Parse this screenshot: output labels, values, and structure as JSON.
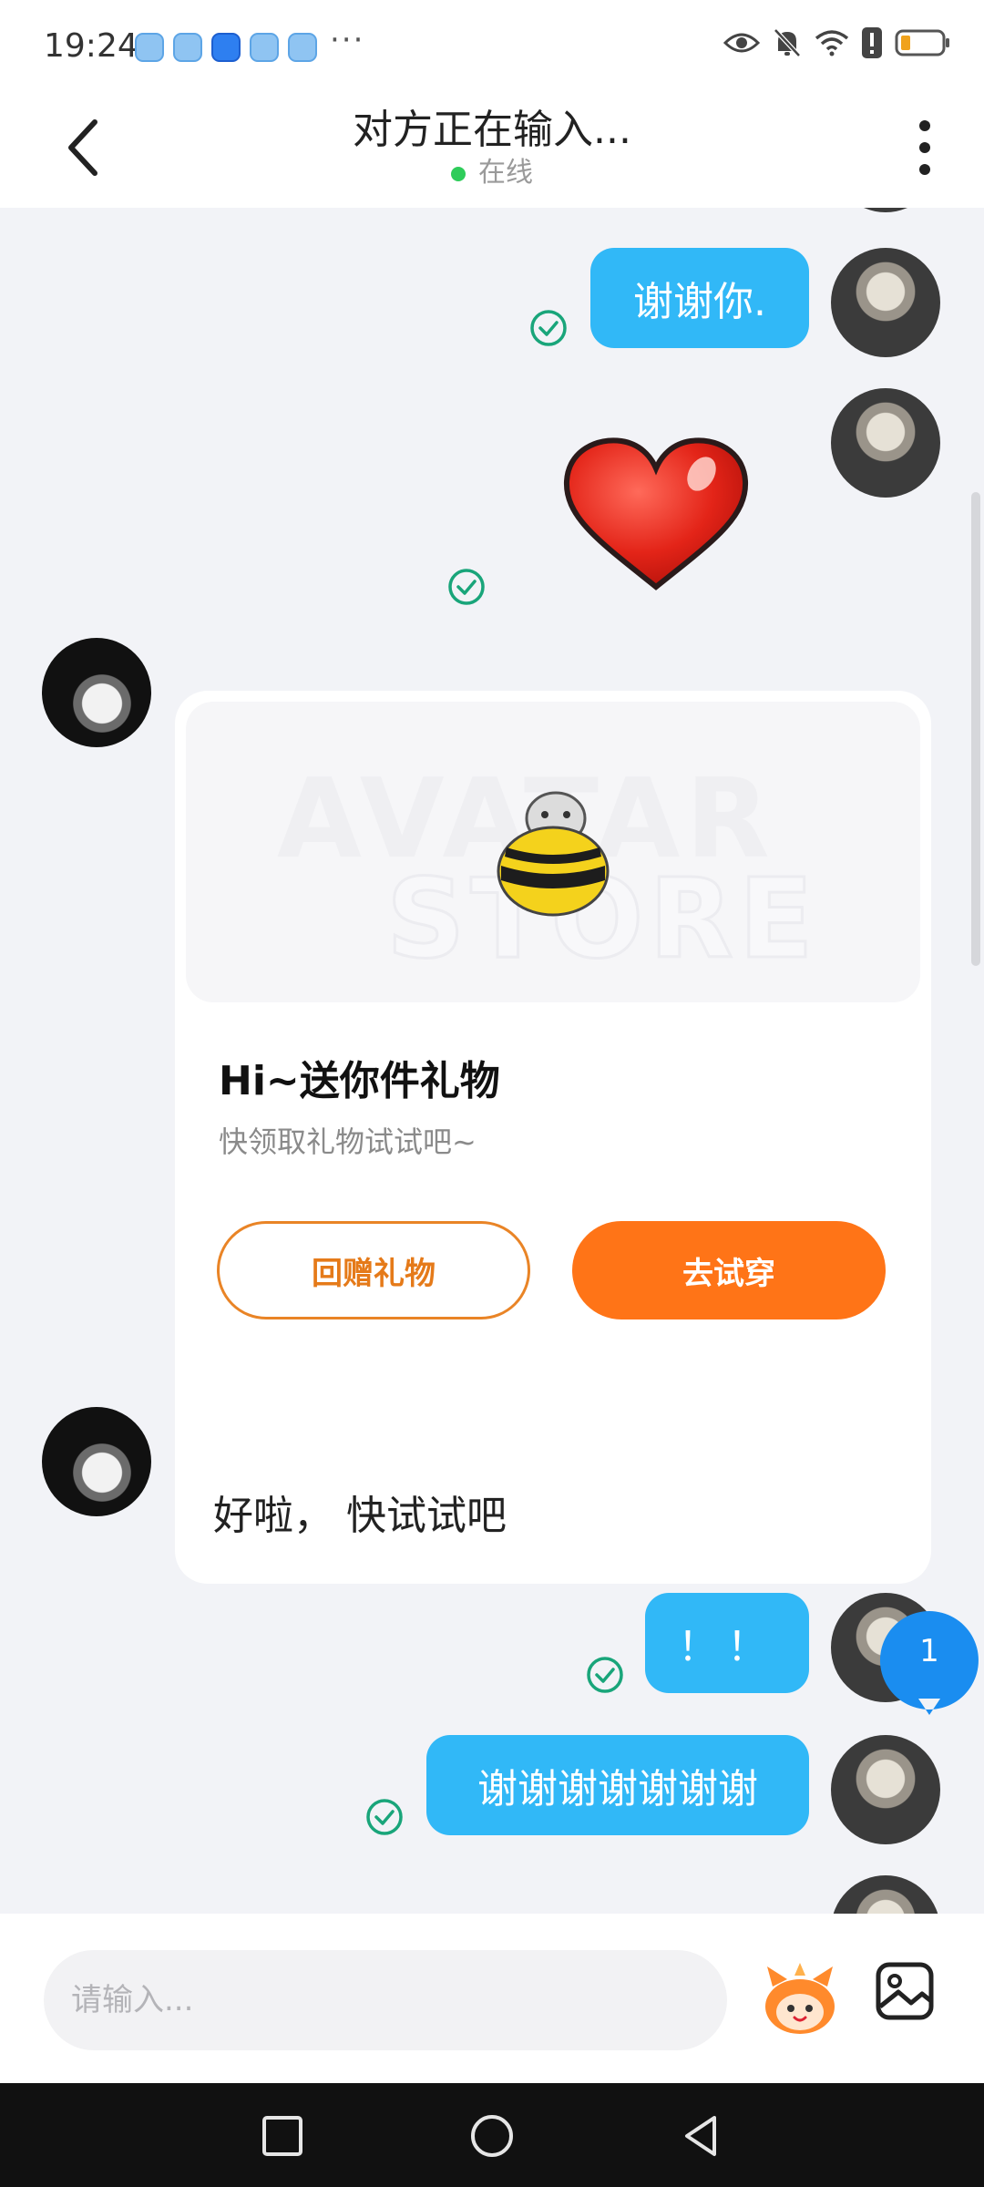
{
  "status_bar": {
    "time": "19:24",
    "more": "···",
    "icons": [
      "eye-icon",
      "bell-off-icon",
      "wifi-icon",
      "alert-icon",
      "battery-icon"
    ]
  },
  "header": {
    "title": "对方正在输入...",
    "status": "在线",
    "online_color": "#2ecc5a"
  },
  "messages": [
    {
      "sender": "me",
      "type": "text",
      "text": "谢谢你.",
      "read": true
    },
    {
      "sender": "me",
      "type": "sticker",
      "sticker": "heart",
      "read": true
    },
    {
      "sender": "other",
      "type": "gift_card",
      "watermark_line1": "AVATAR",
      "watermark_line2": "STORE",
      "title": "Hi~送你件礼物",
      "subtitle": "快领取礼物试试吧~",
      "button_return": "回赠礼物",
      "button_try": "去试穿"
    },
    {
      "sender": "other",
      "type": "text",
      "text": "好啦， 快试试吧"
    },
    {
      "sender": "me",
      "type": "text",
      "text": "！！",
      "read": true
    },
    {
      "sender": "me",
      "type": "text",
      "text": "谢谢谢谢谢谢谢",
      "read": true
    }
  ],
  "unread_badge": "1",
  "input": {
    "placeholder": "请输入..."
  },
  "colors": {
    "my_bubble": "#31b8f7",
    "accent_orange": "#ff7417",
    "read_check": "#19a57a",
    "badge_blue": "#1a8df0"
  },
  "nav": [
    "square-icon",
    "circle-icon",
    "triangle-back-icon"
  ]
}
